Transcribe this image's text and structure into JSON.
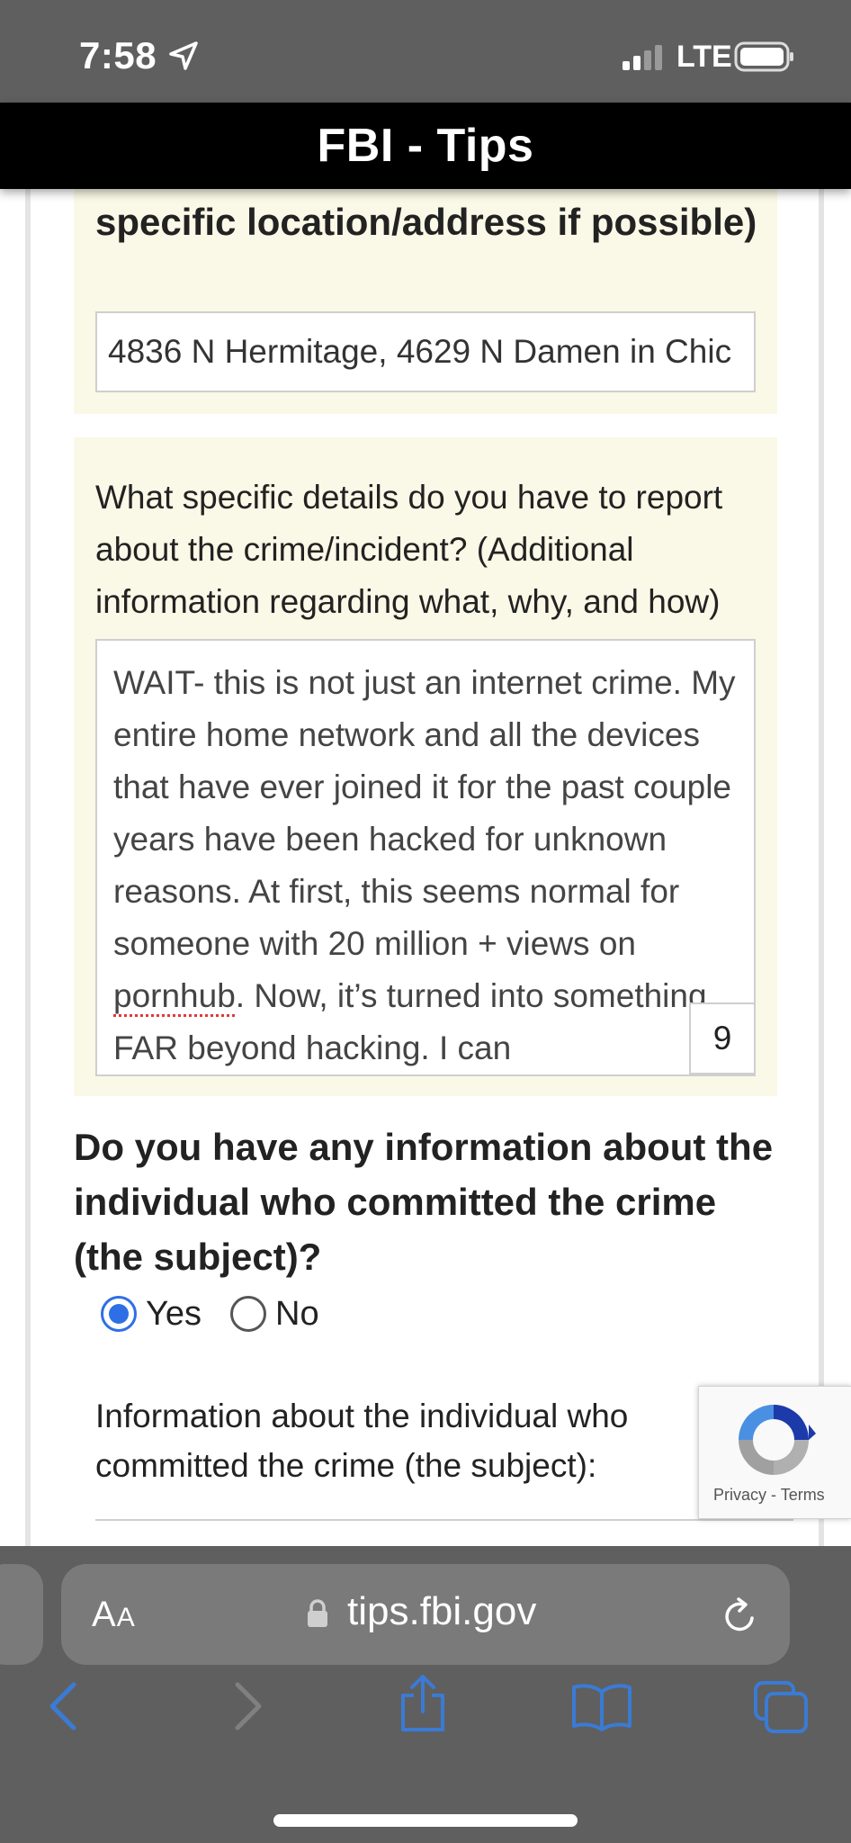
{
  "status_bar": {
    "time": "7:58",
    "network": "LTE"
  },
  "header": {
    "title": "FBI - Tips"
  },
  "form": {
    "location_heading": "specific location/address if possible)",
    "location_value": "4836 N Hermitage, 4629 N Damen in Chic",
    "details_label": "What specific details do you have to report about the crime/incident? (Additional information regarding what, why, and how)",
    "details_value": {
      "before": "WAIT- this is not just an internet crime. My entire home network and all the devices that have ever joined it for the past couple years have been hacked for unknown reasons. At first, this seems normal for someone with 20 million + views on ",
      "misspelled": "pornhub",
      "after": ". Now, it’s turned into something FAR beyond hacking. I can"
    },
    "char_counter": "9",
    "subject_question": "Do you have any information about the individual who committed the crime (the subject)?",
    "radio_yes": "Yes",
    "radio_no": "No",
    "selected": "Yes",
    "subject_info_label": "Information about the individual who committed the crime (the subject):"
  },
  "recaptcha": {
    "privacy": "Privacy",
    "separator": " - ",
    "terms": "Terms"
  },
  "browser": {
    "reader_label_large": "A",
    "reader_label_small": "A",
    "url": "tips.fbi.gov"
  },
  "colors": {
    "panel_background": "#faf8e6",
    "radio_selected": "#2f6fe5",
    "toolbar_icons": "#3a7bd5",
    "title_bar": "#000000",
    "status_bar": "#5f5f5f"
  },
  "icons": {
    "status": [
      "location-arrow-icon",
      "signal-bars-icon",
      "battery-icon"
    ],
    "browser": [
      "lock-icon",
      "reload-icon",
      "back-icon",
      "forward-icon",
      "share-icon",
      "bookmarks-icon",
      "tabs-icon"
    ],
    "recaptcha": "recaptcha-logo-icon"
  }
}
